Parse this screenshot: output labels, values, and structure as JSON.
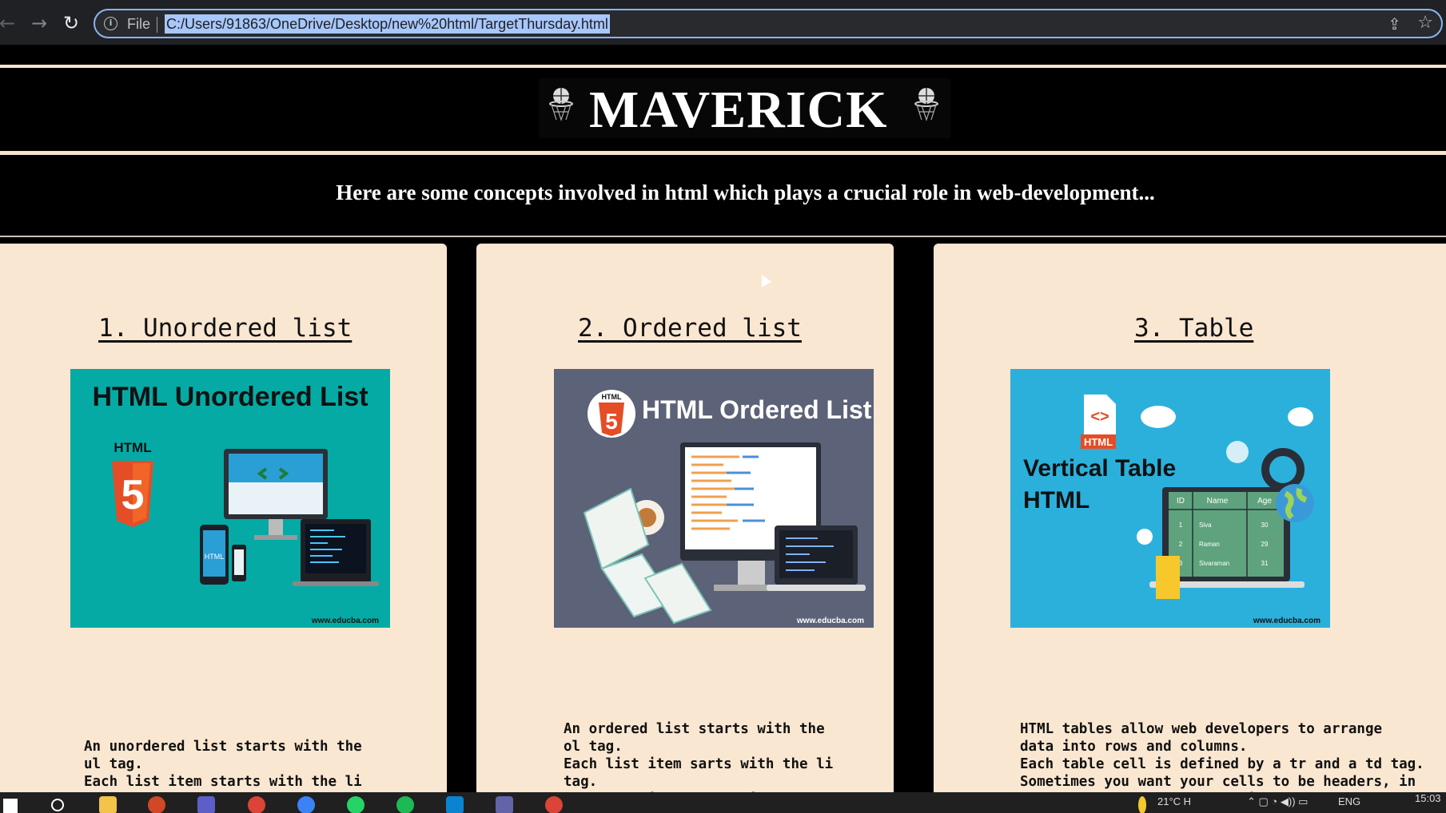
{
  "browser": {
    "file_label": "File",
    "url": "C:/Users/91863/OneDrive/Desktop/new%20html/TargetThursday.html",
    "omnibox_border_color": "#8ab4f8"
  },
  "header": {
    "logo": "MAVERICK",
    "intro": "Here are some concepts involved in html which plays a crucial role in web-development..."
  },
  "cards": [
    {
      "title": "1. Unordered list",
      "image": {
        "heading": "HTML Unordered List",
        "badge": "HTML",
        "badge_number": "5",
        "phone_label": "HTML",
        "watermark": "www.educba.com",
        "background": "#05aaa5"
      },
      "text": "An unordered list starts with the\nul tag.\nEach list item starts with the li\ntag.\nThe types in unordered list in html"
    },
    {
      "title": "2. Ordered list",
      "image": {
        "heading": "HTML Ordered List",
        "badge": "HTML",
        "badge_number": "5",
        "watermark": "www.educba.com",
        "background": "#5c6277"
      },
      "text": "An ordered list starts with the\nol tag.\nEach list item sarts with the li\ntag.\nThe types in ordered list are\nalphabetical or numerical inclu-"
    },
    {
      "title": "3. Table",
      "image": {
        "heading_line1": "Vertical Table",
        "heading_line2": "HTML",
        "file_badge": "HTML",
        "table_headers": [
          "ID",
          "Name",
          "Age"
        ],
        "table_rows": [
          [
            "1",
            "Siva",
            "30"
          ],
          [
            "2",
            "Raman",
            "29"
          ],
          [
            "3",
            "Sivaraman",
            "31"
          ]
        ],
        "watermark": "www.educba.com",
        "background": "#2bb0dc"
      },
      "text": "HTML tables allow web developers to arrange\ndata into rows and columns.\nEach table cell is defined by a tr and a td tag.\nSometimes you want your cells to be headers, in\nthose cases use the th tag instead of the td tag.\n\nThe formatting follo"
    }
  ],
  "taskbar": {
    "weather": "21°C  H",
    "language": "ENG",
    "time": "15:03"
  },
  "colors": {
    "page_bg": "#000000",
    "card_bg": "#fae7d1",
    "divider": "#f8e6cc"
  }
}
